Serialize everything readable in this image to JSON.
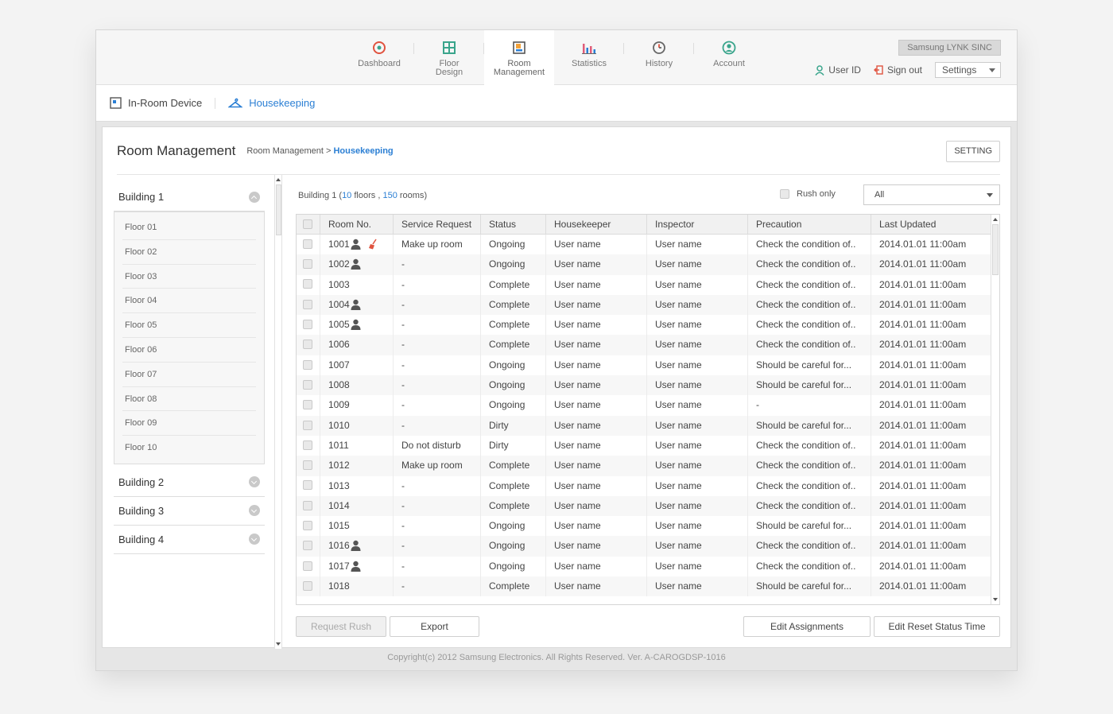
{
  "brand": "Samsung LYNK SINC",
  "nav": [
    {
      "label": "Dashboard",
      "icon": "dashboard-icon",
      "color": "#e0533f"
    },
    {
      "label": "Floor\nDesign",
      "icon": "floor-design-icon",
      "color": "#3aa58c"
    },
    {
      "label": "Room\nManagement",
      "icon": "room-management-icon",
      "color": "#f3a23a",
      "active": true
    },
    {
      "label": "Statistics",
      "icon": "statistics-icon",
      "color": "#e05d7a"
    },
    {
      "label": "History",
      "icon": "history-icon",
      "color": "#e0533f"
    },
    {
      "label": "Account",
      "icon": "account-icon",
      "color": "#3aa58c"
    }
  ],
  "user": {
    "user_id": "User ID",
    "sign_out": "Sign out",
    "settings": "Settings"
  },
  "subnav": {
    "in_room": "In-Room Device",
    "housekeeping": "Housekeeping"
  },
  "panel": {
    "title": "Room Management",
    "crumb_parent": "Room Management",
    "crumb_sep": " > ",
    "crumb_current": "Housekeeping",
    "setting_btn": "SETTING"
  },
  "sidebar": {
    "buildings": [
      "Building 1",
      "Building 2",
      "Building 3",
      "Building 4"
    ],
    "floors": [
      "Floor 01",
      "Floor 02",
      "Floor 03",
      "Floor 04",
      "Floor 05",
      "Floor 06",
      "Floor 07",
      "Floor 08",
      "Floor 09",
      "Floor 10"
    ]
  },
  "info": {
    "building": "Building 1",
    "floors_count": "10",
    "floors_label": "floors",
    "rooms_count": "150",
    "rooms_label": "rooms"
  },
  "rush_only": "Rush only",
  "filter": "All",
  "columns": [
    "Room No.",
    "Service Request",
    "Status",
    "Housekeeper",
    "Inspector",
    "Precaution",
    "Last Updated"
  ],
  "rows": [
    {
      "room": "1001",
      "person": true,
      "broom": true,
      "sr": "Make up room",
      "status": "Ongoing",
      "hk": "User name",
      "in": "User name",
      "pr": "Check the condition of..",
      "lu": "2014.01.01 11:00am"
    },
    {
      "room": "1002",
      "person": true,
      "broom": false,
      "sr": "-",
      "status": "Ongoing",
      "hk": "User name",
      "in": "User name",
      "pr": "Check the condition of..",
      "lu": "2014.01.01 11:00am"
    },
    {
      "room": "1003",
      "person": false,
      "broom": false,
      "sr": "-",
      "status": "Complete",
      "hk": "User name",
      "in": "User name",
      "pr": "Check the condition of..",
      "lu": "2014.01.01 11:00am"
    },
    {
      "room": "1004",
      "person": true,
      "broom": false,
      "sr": "-",
      "status": "Complete",
      "hk": "User name",
      "in": "User name",
      "pr": "Check the condition of..",
      "lu": "2014.01.01 11:00am"
    },
    {
      "room": "1005",
      "person": true,
      "broom": false,
      "sr": "-",
      "status": "Complete",
      "hk": "User name",
      "in": "User name",
      "pr": "Check the condition of..",
      "lu": "2014.01.01 11:00am"
    },
    {
      "room": "1006",
      "person": false,
      "broom": false,
      "sr": "-",
      "status": "Complete",
      "hk": "User name",
      "in": "User name",
      "pr": "Check the condition of..",
      "lu": "2014.01.01 11:00am"
    },
    {
      "room": "1007",
      "person": false,
      "broom": false,
      "sr": "-",
      "status": "Ongoing",
      "hk": "User name",
      "in": "User name",
      "pr": "Should be careful for...",
      "lu": "2014.01.01 11:00am"
    },
    {
      "room": "1008",
      "person": false,
      "broom": false,
      "sr": "-",
      "status": "Ongoing",
      "hk": "User name",
      "in": "User name",
      "pr": "Should be careful for...",
      "lu": "2014.01.01 11:00am"
    },
    {
      "room": "1009",
      "person": false,
      "broom": false,
      "sr": "-",
      "status": "Ongoing",
      "hk": "User name",
      "in": "User name",
      "pr": "-",
      "lu": "2014.01.01 11:00am"
    },
    {
      "room": "1010",
      "person": false,
      "broom": false,
      "sr": "-",
      "status": "Dirty",
      "hk": "User name",
      "in": "User name",
      "pr": "Should be careful for...",
      "lu": "2014.01.01 11:00am"
    },
    {
      "room": "1011",
      "person": false,
      "broom": false,
      "sr": "Do not disturb",
      "status": "Dirty",
      "hk": "User name",
      "in": "User name",
      "pr": "Check the condition of..",
      "lu": "2014.01.01 11:00am"
    },
    {
      "room": "1012",
      "person": false,
      "broom": false,
      "sr": "Make up room",
      "status": "Complete",
      "hk": "User name",
      "in": "User name",
      "pr": "Check the condition of..",
      "lu": "2014.01.01 11:00am"
    },
    {
      "room": "1013",
      "person": false,
      "broom": false,
      "sr": "-",
      "status": "Complete",
      "hk": "User name",
      "in": "User name",
      "pr": "Check the condition of..",
      "lu": "2014.01.01 11:00am"
    },
    {
      "room": "1014",
      "person": false,
      "broom": false,
      "sr": "-",
      "status": "Complete",
      "hk": "User name",
      "in": "User name",
      "pr": "Check the condition of..",
      "lu": "2014.01.01 11:00am"
    },
    {
      "room": "1015",
      "person": false,
      "broom": false,
      "sr": "-",
      "status": "Ongoing",
      "hk": "User name",
      "in": "User name",
      "pr": "Should be careful for...",
      "lu": "2014.01.01 11:00am"
    },
    {
      "room": "1016",
      "person": true,
      "broom": false,
      "sr": "-",
      "status": "Ongoing",
      "hk": "User name",
      "in": "User name",
      "pr": "Check the condition of..",
      "lu": "2014.01.01 11:00am"
    },
    {
      "room": "1017",
      "person": true,
      "broom": false,
      "sr": "-",
      "status": "Ongoing",
      "hk": "User name",
      "in": "User name",
      "pr": "Check the condition of..",
      "lu": "2014.01.01 11:00am"
    },
    {
      "room": "1018",
      "person": false,
      "broom": false,
      "sr": "-",
      "status": "Complete",
      "hk": "User name",
      "in": "User name",
      "pr": "Should be careful for...",
      "lu": "2014.01.01 11:00am"
    }
  ],
  "buttons": {
    "request_rush": "Request Rush",
    "export": "Export",
    "edit_assignments": "Edit Assignments",
    "edit_reset": "Edit Reset Status Time"
  },
  "copyright": "Copyright(c) 2012 Samsung Electronics. All Rights Reserved. Ver. A-CAROGDSP-1016",
  "colors": {
    "accent": "#2b7fd4",
    "broom": "#e0533f"
  }
}
